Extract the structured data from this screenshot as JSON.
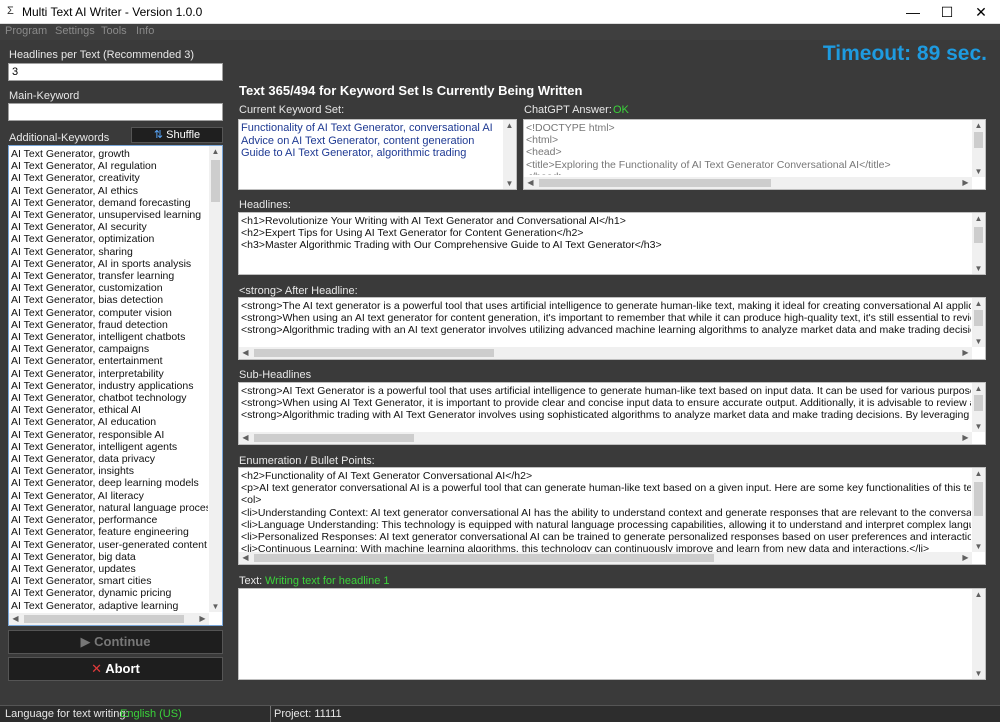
{
  "window": {
    "icon": "Σ",
    "title": "Multi Text AI Writer - Version 1.0.0",
    "minimize": "—",
    "maximize": "☐",
    "close": "✕"
  },
  "menu": [
    "Program",
    "Settings",
    "Tools",
    "Info"
  ],
  "left": {
    "headlines_label": "Headlines per Text (Recommended 3)",
    "headlines_value": "3",
    "main_keyword_label": "Main-Keyword",
    "main_keyword_value": "",
    "additional_label": "Additional-Keywords",
    "shuffle_icon": "⇅",
    "shuffle_label": "Shuffle",
    "keywords": [
      "AI Text Generator, growth",
      "AI Text Generator, AI regulation",
      "AI Text Generator, creativity",
      "AI Text Generator, AI ethics",
      "AI Text Generator, demand forecasting",
      "AI Text Generator, unsupervised learning",
      "AI Text Generator, AI security",
      "AI Text Generator, optimization",
      "AI Text Generator, sharing",
      "AI Text Generator, AI in sports analysis",
      "AI Text Generator, transfer learning",
      "AI Text Generator, customization",
      "AI Text Generator, bias detection",
      "AI Text Generator, computer vision",
      "AI Text Generator, fraud detection",
      "AI Text Generator, intelligent chatbots",
      "AI Text Generator, campaigns",
      "AI Text Generator, entertainment",
      "AI Text Generator, interpretability",
      "AI Text Generator, industry applications",
      "AI Text Generator, chatbot technology",
      "AI Text Generator, ethical AI",
      "AI Text Generator, AI education",
      "AI Text Generator, responsible AI",
      "AI Text Generator, intelligent agents",
      "AI Text Generator, data privacy",
      "AI Text Generator, insights",
      "AI Text Generator, deep learning models",
      "AI Text Generator, AI literacy",
      "AI Text Generator, natural language proces",
      "AI Text Generator, performance",
      "AI Text Generator, feature engineering",
      "AI Text Generator, user-generated content",
      "AI Text Generator, big data",
      "AI Text Generator, updates",
      "AI Text Generator, smart cities",
      "AI Text Generator, dynamic pricing",
      "AI Text Generator, adaptive learning"
    ],
    "continue_icon": "▶",
    "continue_label": "Continue",
    "abort_icon": "✕",
    "abort_label": "Abort"
  },
  "timeout": "Timeout: 89 sec.",
  "progress_heading": "Text 365/494 for Keyword Set Is Currently Being Written",
  "current_set": {
    "label": "Current Keyword Set:",
    "lines": [
      "Functionality of AI Text Generator, conversational AI",
      "Advice on AI Text Generator, content generation",
      "Guide to AI Text Generator, algorithmic trading"
    ]
  },
  "chatgpt": {
    "label": "ChatGPT Answer:",
    "status": "OK",
    "lines": [
      "<!DOCTYPE html>",
      "<html>",
      "<head>",
      "<title>Exploring the Functionality of AI Text Generator Conversational AI</title>",
      "</head>"
    ]
  },
  "headlines": {
    "label": "Headlines:",
    "lines": [
      "<h1>Revolutionize Your Writing with AI Text Generator and Conversational AI</h1>",
      "<h2>Expert Tips for Using AI Text Generator for Content Generation</h2>",
      "<h3>Master Algorithmic Trading with Our Comprehensive Guide to AI Text Generator</h3>"
    ]
  },
  "after_headline": {
    "label": "<strong> After Headline:",
    "lines": [
      "<strong>The AI text generator is a powerful tool that uses artificial intelligence to generate human-like text, making it ideal for creating conversational AI applications.",
      "<strong>When using an AI text generator for content generation, it's important to remember that while it can produce high-quality text, it's still essential to review and e",
      "<strong>Algorithmic trading with an AI text generator involves utilizing advanced machine learning algorithms to analyze market data and make trading decisions. T"
    ]
  },
  "sub_headlines": {
    "label": "Sub-Headlines",
    "lines": [
      "<strong>AI Text Generator is a powerful tool that uses artificial intelligence to generate human-like text based on input data. It can be used for various purposes suc",
      "<strong>When using AI Text Generator, it is important to provide clear and concise input data to ensure accurate output. Additionally, it is advisable to review and e",
      "<strong>Algorithmic trading with AI Text Generator involves using sophisticated algorithms to analyze market data and make trading decisions. By leveraging AI T"
    ]
  },
  "enumeration": {
    "label": "Enumeration / Bullet Points:",
    "lines": [
      "<h2>Functionality of AI Text Generator Conversational AI</h2>",
      "<p>AI text generator conversational AI is a powerful tool that can generate human-like text based on a given input. Here are some key functionalities of this technolo",
      "<ol>",
      "<li>Understanding Context: AI text generator conversational AI has the ability to understand context and generate responses that are relevant to the conversation.</",
      "<li>Language Understanding: This technology is equipped with natural language processing capabilities, allowing it to understand and interpret complex language",
      "<li>Personalized Responses: AI text generator conversational AI can be trained to generate personalized responses based on user preferences and interactions.",
      "<li>Continuous Learning: With machine learning algorithms, this technology can continuously improve and learn from new data and interactions.</li>"
    ]
  },
  "text": {
    "label": "Text:",
    "status": "Writing text for headline 1"
  },
  "status": {
    "language_label": "Language for text writing:",
    "language_value": "English (US)",
    "project": "Project: 11111"
  },
  "colors": {
    "accent_blue": "#1e9be0",
    "ok_green": "#3ad33a",
    "keyword_text": "#1f3a93",
    "abort_red": "#e03a3a"
  }
}
